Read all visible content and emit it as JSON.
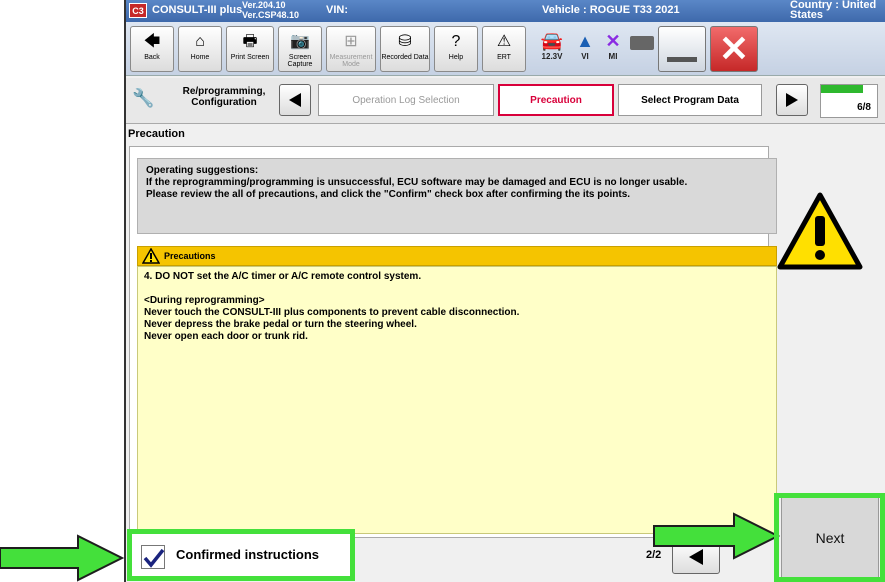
{
  "titlebar": {
    "app_name": "CONSULT-III plus",
    "version_1": "Ver.204.10",
    "version_2": "Ver.CSP48.10",
    "vin_label": "VIN:",
    "vehicle": "Vehicle : ROGUE T33 2021",
    "country": "Country : United States"
  },
  "toolbar": {
    "back": "Back",
    "home": "Home",
    "print_screen": "Print Screen",
    "screen_capture": "Screen Capture",
    "measurement_mode": "Measurement Mode",
    "recorded_data": "Recorded Data",
    "help": "Help",
    "ert": "ERT",
    "voltage": "12.3V",
    "vi": "VI",
    "mi": "MI"
  },
  "nav": {
    "reprog_label": "Re/programming, Configuration",
    "step_operation_log": "Operation Log Selection",
    "step_precaution": "Precaution",
    "step_select_program": "Select Program Data",
    "step_counter": "6/8"
  },
  "page": {
    "section_title": "Precaution"
  },
  "operating": {
    "heading": "Operating suggestions:",
    "line1": "If the reprogramming/programming is unsuccessful, ECU software may be damaged and ECU is no longer usable.",
    "line2": "Please review the all of precautions, and click the \"Confirm\" check box after confirming the its points."
  },
  "precautions": {
    "heading": "Precautions",
    "item4": "4. DO NOT set the A/C timer or A/C remote control system.",
    "during_heading": "<During reprogramming>",
    "during_1": "Never touch the CONSULT-III plus components to prevent cable disconnection.",
    "during_2": "Never depress the brake pedal or turn the steering wheel.",
    "during_3": "Never open each door or trunk rid."
  },
  "footer": {
    "confirm_label": "Confirmed instructions",
    "page_indicator": "2/2",
    "next_label": "Next"
  },
  "colors": {
    "highlight_green": "#44e03b",
    "precaution_yellow": "#f5c400",
    "active_step": "#d8003a"
  }
}
